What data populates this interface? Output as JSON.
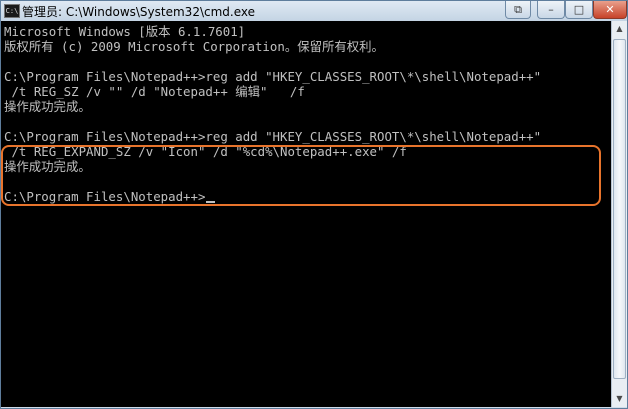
{
  "window": {
    "title": "管理员: C:\\Windows\\System32\\cmd.exe",
    "icon": "cmd-icon",
    "icon_label": "C:\\",
    "controls": {
      "extra": "⧉",
      "minimize": "–",
      "maximize": "□",
      "close": "✕"
    }
  },
  "console": {
    "lines": [
      "Microsoft Windows [版本 6.1.7601]",
      "版权所有 (c) 2009 Microsoft Corporation。保留所有权利。",
      "",
      "C:\\Program Files\\Notepad++>reg add \"HKEY_CLASSES_ROOT\\*\\shell\\Notepad++\"",
      " /t REG_SZ /v \"\" /d \"Notepad++ 编辑\"   /f",
      "操作成功完成。",
      "",
      "C:\\Program Files\\Notepad++>reg add \"HKEY_CLASSES_ROOT\\*\\shell\\Notepad++\"",
      " /t REG_EXPAND_SZ /v \"Icon\" /d \"%cd%\\Notepad++.exe\" /f",
      "操作成功完成。",
      "",
      "C:\\Program Files\\Notepad++>"
    ],
    "text_color": "#c0c0c0",
    "background": "#000000",
    "highlight_color": "#e8742c"
  },
  "scrollbar": {
    "up_arrow": "▲",
    "down_arrow": "▼"
  }
}
